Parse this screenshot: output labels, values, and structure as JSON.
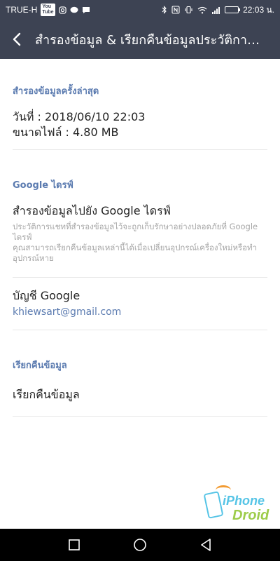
{
  "status_bar": {
    "carrier": "TRUE-H",
    "yt_badge": "YouTube",
    "time": "22:03 น."
  },
  "app_bar": {
    "title": "สำรองข้อมูล & เรียกคืนข้อมูลประวัติการแชท"
  },
  "sections": {
    "last_backup": {
      "header": "สำรองข้อมูลครั้งล่าสุด",
      "date": "วันที่ : 2018/06/10 22:03",
      "size": "ขนาดไฟล์ : 4.80 MB"
    },
    "google_drive": {
      "header": "Google ไดรฟ์",
      "backup_title": "สำรองข้อมูลไปยัง Google ไดรฟ์",
      "backup_desc_1": "ประวัติการแชทที่สำรองข้อมูลไว้จะถูกเก็บรักษาอย่างปลอดภัยที่ Google ไดรฟ์",
      "backup_desc_2": "คุณสามารถเรียกคืนข้อมูลเหล่านี้ได้เมื่อเปลี่ยนอุปกรณ์เครื่องใหม่หรือทำอุปกรณ์หาย",
      "account_title": "บัญชี Google",
      "account_email": "khiewsart@gmail.com"
    },
    "restore": {
      "header": "เรียกคืนข้อมูล",
      "restore_item": "เรียกคืนข้อมูล"
    }
  },
  "watermark": {
    "line1": "iPhone",
    "line2": "Droid"
  },
  "colors": {
    "bar_bg": "#3d4353",
    "accent": "#5b7bb0",
    "primary_text": "#222222",
    "secondary_text": "#a6a6a6"
  },
  "status": {
    "battery_level_percent": 50
  }
}
